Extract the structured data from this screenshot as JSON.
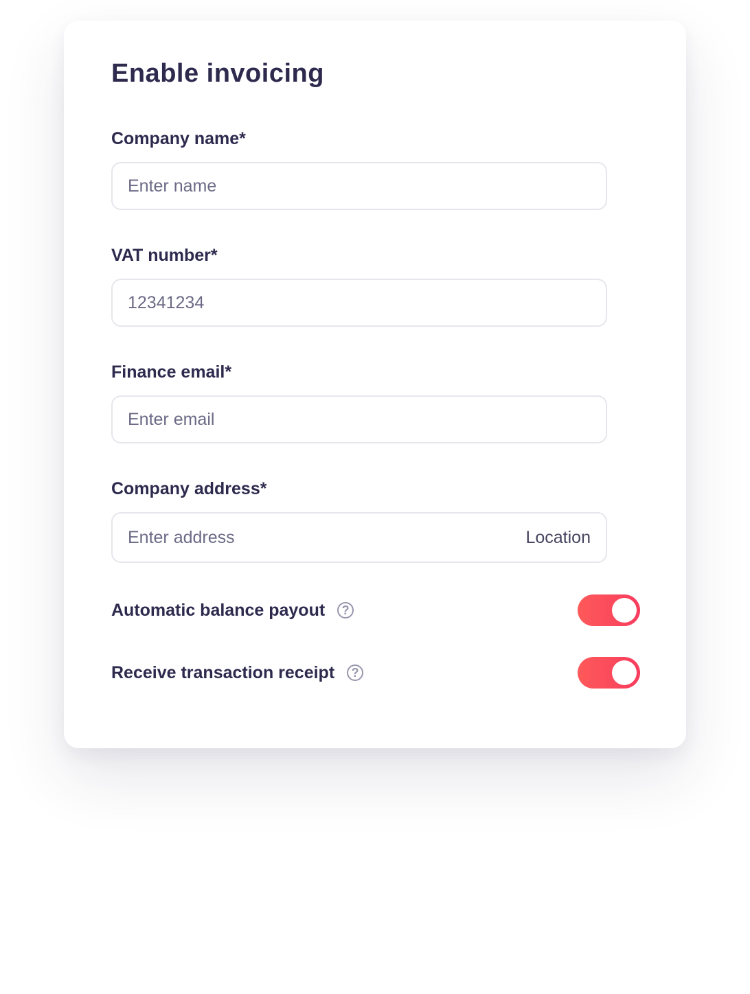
{
  "title": "Enable invoicing",
  "fields": [
    {
      "label": "Company name*",
      "placeholder": "Enter name"
    },
    {
      "label": "VAT number*",
      "value": "12341234"
    },
    {
      "label": "Finance email*",
      "placeholder": "Enter email"
    },
    {
      "label": "Company address*",
      "placeholder": "Enter address",
      "suffix": "Location"
    }
  ],
  "toggles": [
    {
      "label": "Automatic balance payout",
      "on": true,
      "help_icon": "question-circle-icon"
    },
    {
      "label": "Receive transaction receipt",
      "on": true,
      "help_icon": "question-circle-icon"
    }
  ],
  "help_glyph": "?",
  "accent_color": "#f83c5e"
}
